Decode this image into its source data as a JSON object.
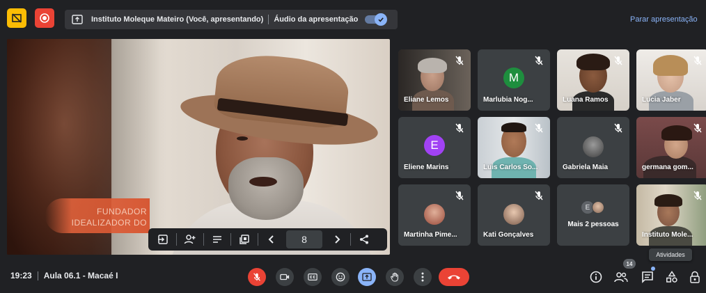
{
  "header": {
    "presenting_label": "Instituto Moleque Mateiro (Você, apresentando)",
    "audio_label": "Áudio da apresentação",
    "audio_enabled": true,
    "stop_presenting": "Parar apresentação"
  },
  "presentation": {
    "overlay_line1": "FUNDADOR",
    "overlay_line2": "IDEALIZADOR DO",
    "current_slide": "8"
  },
  "participants": [
    {
      "name": "Eliane Lemos",
      "muted": true,
      "type": "video"
    },
    {
      "name": "Marlubia Nog...",
      "muted": true,
      "type": "letter",
      "letter": "M",
      "color": "#1e8e3e"
    },
    {
      "name": "Luana Ramos",
      "muted": true,
      "type": "video"
    },
    {
      "name": "Lucia Jaber",
      "muted": true,
      "type": "video"
    },
    {
      "name": "Eliene Marins",
      "muted": true,
      "type": "letter",
      "letter": "E",
      "color": "#a142f4"
    },
    {
      "name": "Luis Carlos So...",
      "muted": true,
      "type": "video"
    },
    {
      "name": "Gabriela Maia",
      "muted": true,
      "type": "photo"
    },
    {
      "name": "germana gom...",
      "muted": true,
      "type": "video"
    },
    {
      "name": "Martinha Pime...",
      "muted": true,
      "type": "photo"
    },
    {
      "name": "Kati Gonçalves",
      "muted": true,
      "type": "photo"
    },
    {
      "name": "Mais 2 pessoas",
      "type": "more",
      "letter": "E"
    },
    {
      "name": "Instituto Mole...",
      "muted": true,
      "type": "video"
    }
  ],
  "footer": {
    "time": "19:23",
    "meeting_name": "Aula 06.1 - Macaé I",
    "people_count": "14",
    "activities_tooltip": "Atividades"
  },
  "colors": {
    "accent_blue": "#8ab4f8",
    "danger_red": "#ea4335",
    "background": "#202124",
    "tile_bg": "#3c4043"
  }
}
